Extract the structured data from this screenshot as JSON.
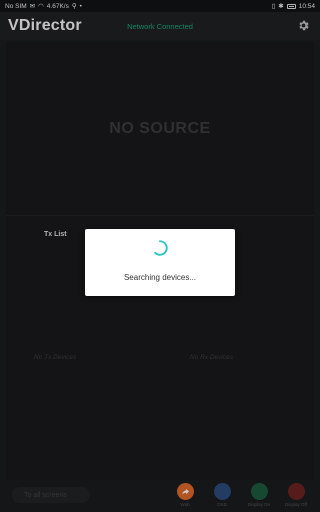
{
  "status_bar": {
    "carrier": "No SIM",
    "speed": "4.67K/s",
    "time": "10:54"
  },
  "app": {
    "logo": "VDirector",
    "network_status": "Network Connected"
  },
  "preview": {
    "placeholder": "NO SOURCE"
  },
  "lists": {
    "tx_title": "Tx List",
    "tx_empty": "No Tx Devices",
    "rx_empty": "No Rx Devices"
  },
  "bottom_bar": {
    "search_placeholder": "To all screens",
    "buttons": [
      {
        "label": "Web",
        "color": "#d8672a"
      },
      {
        "label": "OSD",
        "color": "#2a5ea8"
      },
      {
        "label": "Display On",
        "color": "#1f8a55"
      },
      {
        "label": "Display Off",
        "color": "#b83030"
      }
    ]
  },
  "dialog": {
    "message": "Searching devices...",
    "spinner_color": "#26c6c6"
  }
}
